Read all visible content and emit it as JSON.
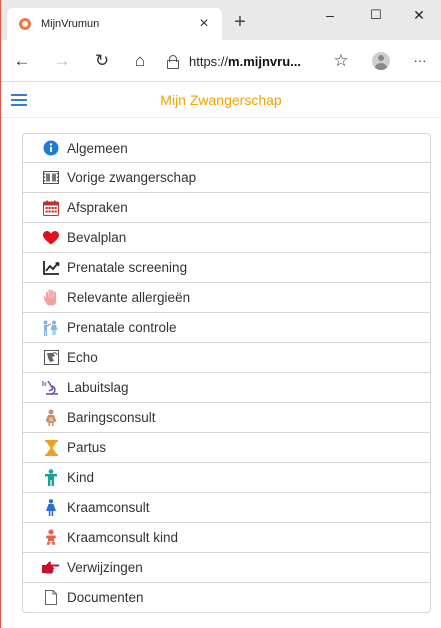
{
  "browser": {
    "tab_title": "MijnVrumun",
    "tab_close": "×",
    "new_tab": "+",
    "minimize": "–",
    "maximize": "☐",
    "close": "✕",
    "back": "←",
    "forward": "→",
    "refresh": "↻",
    "home": "⌂",
    "url_prefix": "https://",
    "url_bold": "m.mijnvru...",
    "favorite": "☆",
    "more": "···"
  },
  "app": {
    "title": "Mijn Zwangerschap"
  },
  "menu": {
    "items": [
      {
        "label": "Algemeen",
        "icon": "info-icon"
      },
      {
        "label": "Vorige zwangerschap",
        "icon": "film-icon"
      },
      {
        "label": "Afspraken",
        "icon": "calendar-icon"
      },
      {
        "label": "Bevalplan",
        "icon": "heart-icon"
      },
      {
        "label": "Prenatale screening",
        "icon": "chart-icon"
      },
      {
        "label": "Relevante allergieën",
        "icon": "hand-icon"
      },
      {
        "label": "Prenatale controle",
        "icon": "people-icon"
      },
      {
        "label": "Echo",
        "icon": "echo-icon"
      },
      {
        "label": "Labuitslag",
        "icon": "microscope-icon"
      },
      {
        "label": "Baringsconsult",
        "icon": "pregnant-icon"
      },
      {
        "label": "Partus",
        "icon": "hourglass-icon"
      },
      {
        "label": "Kind",
        "icon": "child-icon"
      },
      {
        "label": "Kraamconsult",
        "icon": "woman-icon"
      },
      {
        "label": "Kraamconsult kind",
        "icon": "baby-icon"
      },
      {
        "label": "Verwijzingen",
        "icon": "pointing-hand-icon"
      },
      {
        "label": "Documenten",
        "icon": "document-icon"
      }
    ]
  },
  "colors": {
    "accent": "#f5a100",
    "hamburger": "#2f7ed8",
    "info": "#1e7bd7",
    "calendar": "#c8302c",
    "heart": "#e0101e",
    "hand": "#f4a0a0",
    "people": "#7fb6e8",
    "microscope": "#7a4fb0",
    "pregnant": "#c98f6a",
    "hourglass": "#f0a020",
    "child": "#1aa39a",
    "woman": "#2a6fc9",
    "baby": "#e8614a",
    "pointer": "#c8102e"
  }
}
